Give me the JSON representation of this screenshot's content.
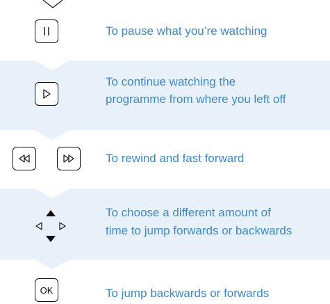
{
  "rows": [
    {
      "text": "To pause what you’re watching",
      "icon": "pause-icon"
    },
    {
      "text_line1": "To continue watching the",
      "text_line2": "programme from where you left off",
      "icon": "play-icon"
    },
    {
      "text": "To rewind and fast forward",
      "icons": [
        "rewind-icon",
        "fast-forward-icon"
      ]
    },
    {
      "text_line1": "To choose a different amount of",
      "text_line2": "time to jump forwards or backwards",
      "icon": "dpad-icon"
    },
    {
      "text": "To jump backwards or forwards",
      "icon": "ok-icon",
      "key_label": "OK"
    }
  ],
  "colors": {
    "text": "#3f88c5",
    "band_tint": "#e8f1fa",
    "key_border": "#111111"
  }
}
